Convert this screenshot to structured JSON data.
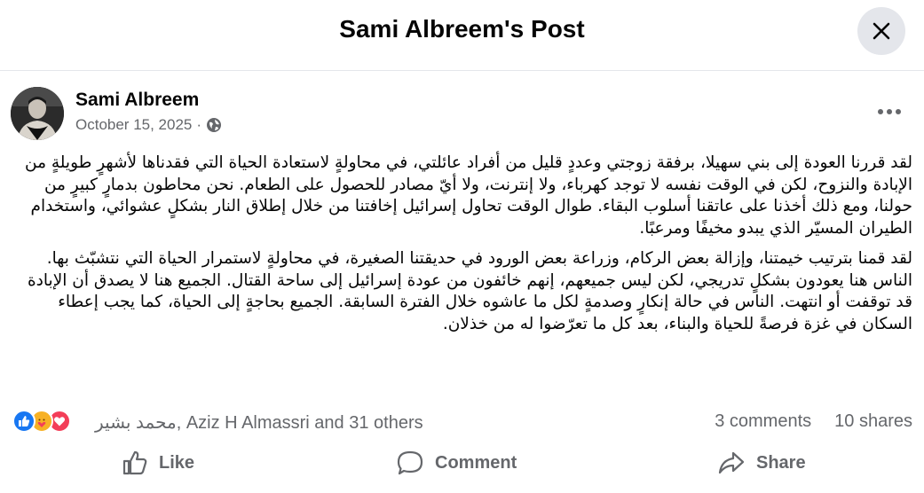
{
  "header": {
    "title": "Sami Albreem's Post",
    "close_icon": "close-icon"
  },
  "post": {
    "author": "Sami Albreem",
    "date": "October 15, 2025",
    "date_separator": "·",
    "audience_icon": "globe-icon",
    "more_icon": "more-horizontal-icon",
    "paragraphs": [
      "لقد قررنا العودة إلى بني سهيلا، برفقة زوجتي وعددٍ قليل من أفراد عائلتي، في محاولةٍ لاستعادة الحياة التي فقدناها لأشهرٍ طويلةٍ من الإبادة والنزوح، لكن في الوقت نفسه لا توجد كهرباء، ولا إنترنت، ولا أيّ مصادر للحصول على الطعام. نحن محاطون بدمارٍ كبيرٍ من حولنا، ومع ذلك أخذنا على عاتقنا أسلوب البقاء. طوال الوقت تحاول إسرائيل إخافتنا من خلال إطلاق النار بشكلٍ عشوائي، واستخدام الطيران المسيّر الذي يبدو مخيفًا ومرعبًا.",
      "لقد قمنا بترتيب خيمتنا، وإزالة بعض الركام، وزراعة بعض الورود في حديقتنا الصغيرة، في محاولةٍ لاستمرار الحياة التي نتشبّث بها. الناس هنا يعودون بشكلٍ تدريجي، لكن ليس جميعهم، إنهم خائفون من عودة إسرائيل إلى ساحة القتال. الجميع هنا لا يصدق أن الإبادة قد توقفت أو انتهت. الناس في حالة إنكارٍ وصدمةٍ لكل ما عاشوه خلال الفترة السابقة. الجميع بحاجةٍ إلى الحياة، كما يجب إعطاء السكان في غزة فرصةً للحياة والبناء، بعد كل ما تعرّضوا له من خذلان."
    ]
  },
  "stats": {
    "reaction_icons": [
      "like-icon",
      "care-icon",
      "love-icon"
    ],
    "reactors_text": "محمد بشير, Aziz H Almassri and 31 others",
    "comments": "3 comments",
    "shares": "10 shares"
  },
  "actions": {
    "like": "Like",
    "comment": "Comment",
    "share": "Share"
  },
  "colors": {
    "like_blue": "#1877f2",
    "care_yellow": "#f7b125",
    "love_red": "#f33e58",
    "secondary_text": "#65676b",
    "close_bg": "#e4e6eb"
  }
}
